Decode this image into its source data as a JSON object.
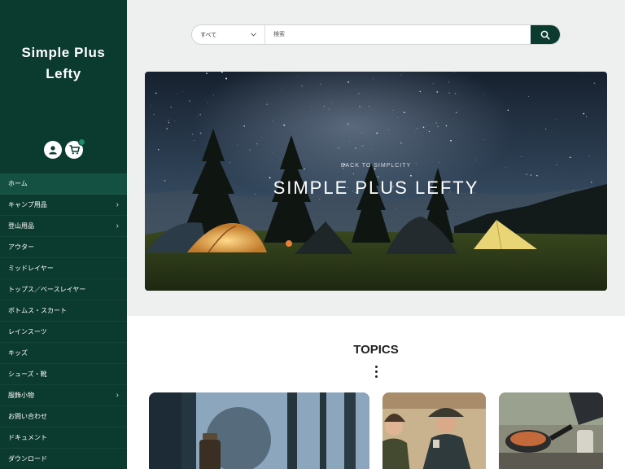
{
  "brand": {
    "line1": "Simple Plus",
    "line2": "Lefty"
  },
  "header_icons": {
    "account": "user-icon",
    "cart": "cart-icon"
  },
  "nav": [
    {
      "label": "ホーム",
      "arrow": false,
      "active": true
    },
    {
      "label": "キャンプ用品",
      "arrow": true
    },
    {
      "label": "登山用品",
      "arrow": true
    },
    {
      "label": "アウター",
      "arrow": false
    },
    {
      "label": "ミッドレイヤー",
      "arrow": false
    },
    {
      "label": "トップス／ベースレイヤー",
      "arrow": false
    },
    {
      "label": "ボトムス・スカート",
      "arrow": false
    },
    {
      "label": "レインスーツ",
      "arrow": false
    },
    {
      "label": "キッズ",
      "arrow": false
    },
    {
      "label": "シューズ・靴",
      "arrow": false
    },
    {
      "label": "服飾小物",
      "arrow": true
    },
    {
      "label": "お問い合わせ",
      "arrow": false
    },
    {
      "label": "ドキュメント",
      "arrow": false
    },
    {
      "label": "ダウンロード",
      "arrow": false
    }
  ],
  "search": {
    "category": "すべて",
    "placeholder": "検索"
  },
  "hero": {
    "subtitle": "BACK TO SIMPLCITY",
    "title": "SIMPLE PLUS LEFTY"
  },
  "topics": {
    "title": "TOPICS"
  },
  "colors": {
    "sidebar": "#0b3a2e",
    "accent": "#0b3a2e",
    "active_nav": "#145142"
  }
}
